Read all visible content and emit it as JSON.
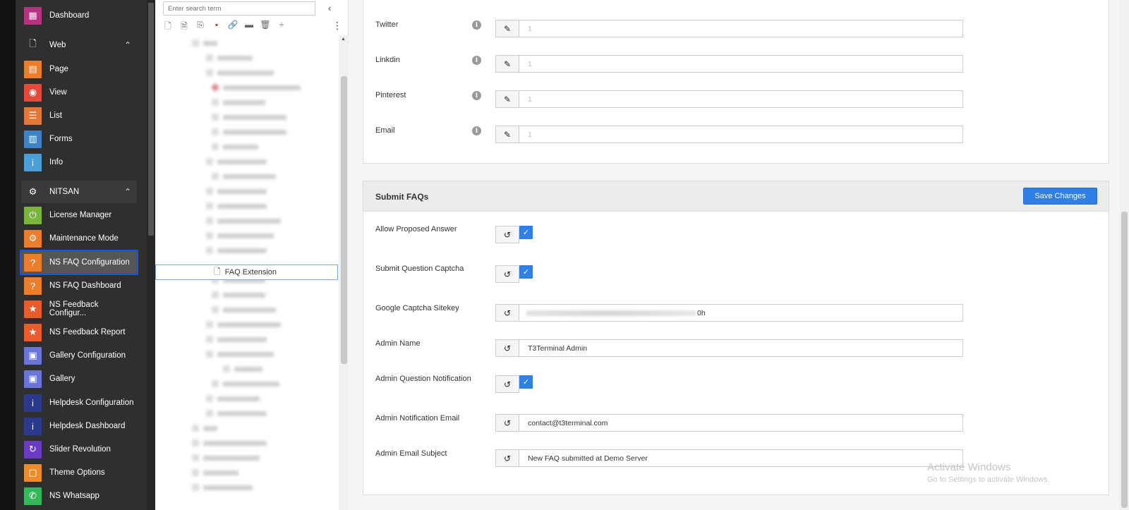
{
  "sidebar": {
    "items": [
      {
        "label": "Dashboard",
        "icon": "dashboard-icon",
        "color": "#b5337f"
      },
      {
        "label": "Web",
        "icon": "page-outline-icon",
        "group": true
      },
      {
        "label": "Page",
        "icon": "page-icon",
        "color": "#ec7e2b"
      },
      {
        "label": "View",
        "icon": "eye-icon",
        "color": "#e34a3a"
      },
      {
        "label": "List",
        "icon": "list-icon",
        "color": "#e2773a"
      },
      {
        "label": "Forms",
        "icon": "forms-icon",
        "color": "#4083c4"
      },
      {
        "label": "Info",
        "icon": "info-icon",
        "color": "#4a9fd8"
      },
      {
        "label": "NITSAN",
        "icon": "gear-icon",
        "group": true
      },
      {
        "label": "License Manager",
        "icon": "power-icon",
        "color": "#7ab53c"
      },
      {
        "label": "Maintenance Mode",
        "icon": "maintenance-icon",
        "color": "#ec7e2b"
      },
      {
        "label": "NS FAQ Configuration",
        "icon": "faq-icon",
        "color": "#ec7e2b"
      },
      {
        "label": "NS FAQ Dashboard",
        "icon": "faq-icon",
        "color": "#ec7e2b"
      },
      {
        "label": "NS Feedback Configur...",
        "icon": "star-icon",
        "color": "#ec5b2b"
      },
      {
        "label": "NS Feedback Report",
        "icon": "star-icon",
        "color": "#ec5b2b"
      },
      {
        "label": "Gallery Configuration",
        "icon": "gallery-icon",
        "color": "#6a75d8"
      },
      {
        "label": "Gallery",
        "icon": "gallery-icon",
        "color": "#6a75d8"
      },
      {
        "label": "Helpdesk Configuration",
        "icon": "info-icon",
        "color": "#2b3a8c"
      },
      {
        "label": "Helpdesk Dashboard",
        "icon": "info-icon",
        "color": "#2b3a8c"
      },
      {
        "label": "Slider Revolution",
        "icon": "refresh-icon",
        "color": "#6a3cc4"
      },
      {
        "label": "Theme Options",
        "icon": "box-icon",
        "color": "#ec8c2b"
      },
      {
        "label": "NS Whatsapp",
        "icon": "whatsapp-icon",
        "color": "#35b85a"
      }
    ]
  },
  "tree": {
    "search_placeholder": "Enter search term",
    "selected_page": "FAQ Extension"
  },
  "social": {
    "rows": [
      {
        "label": "Twitter",
        "value": "1"
      },
      {
        "label": "Linkdin",
        "value": "1"
      },
      {
        "label": "Pinterest",
        "value": "1"
      },
      {
        "label": "Email",
        "value": "1"
      }
    ]
  },
  "submit_faqs": {
    "title": "Submit FAQs",
    "save_label": "Save Changes",
    "allow_proposed_answer": "Allow Proposed Answer",
    "submit_question_captcha": "Submit Question Captcha",
    "google_captcha_sitekey": "Google Captcha Sitekey",
    "sitekey_suffix": "0h",
    "admin_name_label": "Admin Name",
    "admin_name_value": "T3Terminal Admin",
    "admin_question_notification": "Admin Question Notification",
    "admin_notification_email_label": "Admin Notification Email",
    "admin_notification_email_value": "contact@t3terminal.com",
    "admin_email_subject_label": "Admin Email Subject",
    "admin_email_subject_value": "New FAQ submitted at Demo Server"
  },
  "watermark": {
    "line1": "Activate Windows",
    "line2": "Go to Settings to activate Windows."
  },
  "colors": {
    "primary": "#2f7fe4",
    "sidebar_bg": "#2f2f2f",
    "active_outline": "#1a56d6"
  }
}
